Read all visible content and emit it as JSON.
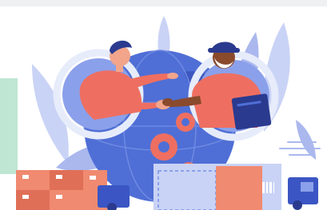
{
  "illustration": {
    "subject": "",
    "colors": {
      "leaf": "#c9d3f5",
      "leaf_dark": "#aab8ee",
      "globe": "#4f6fd6",
      "globe_dark": "#3c57be",
      "ring": "#e7ecfb",
      "skin_light": "#f2a58b",
      "skin_dark": "#8a4a2c",
      "shirt": "#ee6f61",
      "cap": "#2a3a8f",
      "box": "#f08a70",
      "box_dark": "#e06f57",
      "truck": "#3b56c4",
      "gear": "#ee6f61"
    }
  },
  "label_box": {
    "barcode": ""
  }
}
